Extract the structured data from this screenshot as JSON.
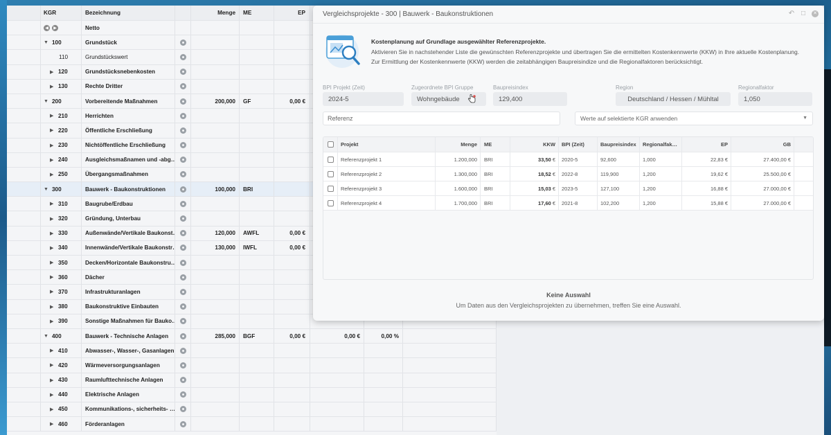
{
  "grid": {
    "headers": {
      "kgr": "KGR",
      "bezeichnung": "Bezeichnung",
      "menge": "Menge",
      "me": "ME",
      "ep": "EP"
    },
    "netto_label": "Netto",
    "rows": [
      {
        "kgr": "100",
        "name": "Grundstück",
        "level": 0,
        "toggle": "▼",
        "menge": "",
        "me": "",
        "ep": "",
        "gb": "",
        "pct": ""
      },
      {
        "kgr": "110",
        "name": "Grundstückswert",
        "level": 2,
        "toggle": "",
        "menge": "",
        "me": "",
        "ep": "",
        "gb": "",
        "pct": ""
      },
      {
        "kgr": "120",
        "name": "Grundstücksnebenkosten",
        "level": 1,
        "toggle": "▶",
        "menge": "",
        "me": "",
        "ep": "",
        "gb": "",
        "pct": ""
      },
      {
        "kgr": "130",
        "name": "Rechte Dritter",
        "level": 1,
        "toggle": "▶",
        "menge": "",
        "me": "",
        "ep": "",
        "gb": "",
        "pct": ""
      },
      {
        "kgr": "200",
        "name": "Vorbereitende Maßnahmen",
        "level": 0,
        "toggle": "▼",
        "menge": "200,000",
        "me": "GF",
        "ep": "0,00 €",
        "gb": "",
        "pct": ""
      },
      {
        "kgr": "210",
        "name": "Herrichten",
        "level": 1,
        "toggle": "▶",
        "menge": "",
        "me": "",
        "ep": "",
        "gb": "",
        "pct": ""
      },
      {
        "kgr": "220",
        "name": "Öffentliche Erschließung",
        "level": 1,
        "toggle": "▶",
        "menge": "",
        "me": "",
        "ep": "",
        "gb": "",
        "pct": ""
      },
      {
        "kgr": "230",
        "name": "Nichtöffentliche Erschließung",
        "level": 1,
        "toggle": "▶",
        "menge": "",
        "me": "",
        "ep": "",
        "gb": "",
        "pct": ""
      },
      {
        "kgr": "240",
        "name": "Ausgleichsmaßnamen und -abg…",
        "level": 1,
        "toggle": "▶",
        "menge": "",
        "me": "",
        "ep": "",
        "gb": "",
        "pct": ""
      },
      {
        "kgr": "250",
        "name": "Übergangsmaßnahmen",
        "level": 1,
        "toggle": "▶",
        "menge": "",
        "me": "",
        "ep": "",
        "gb": "",
        "pct": ""
      },
      {
        "kgr": "300",
        "name": "Bauwerk - Baukonstruktionen",
        "level": 0,
        "toggle": "▼",
        "menge": "100,000",
        "me": "BRI",
        "ep": "",
        "gb": "",
        "pct": "",
        "highlight": true
      },
      {
        "kgr": "310",
        "name": "Baugrube/Erdbau",
        "level": 1,
        "toggle": "▶",
        "menge": "",
        "me": "",
        "ep": "",
        "gb": "",
        "pct": ""
      },
      {
        "kgr": "320",
        "name": "Gründung, Unterbau",
        "level": 1,
        "toggle": "▶",
        "menge": "",
        "me": "",
        "ep": "",
        "gb": "",
        "pct": ""
      },
      {
        "kgr": "330",
        "name": "Außenwände/Vertikale Baukonst…",
        "level": 1,
        "toggle": "▶",
        "menge": "120,000",
        "me": "AWFL",
        "ep": "0,00 €",
        "gb": "",
        "pct": ""
      },
      {
        "kgr": "340",
        "name": "Innenwände/Vertikale Baukonstr…",
        "level": 1,
        "toggle": "▶",
        "menge": "130,000",
        "me": "IWFL",
        "ep": "0,00 €",
        "gb": "",
        "pct": ""
      },
      {
        "kgr": "350",
        "name": "Decken/Horizontale Baukonstru…",
        "level": 1,
        "toggle": "▶",
        "menge": "",
        "me": "",
        "ep": "",
        "gb": "",
        "pct": ""
      },
      {
        "kgr": "360",
        "name": "Dächer",
        "level": 1,
        "toggle": "▶",
        "menge": "",
        "me": "",
        "ep": "",
        "gb": "",
        "pct": ""
      },
      {
        "kgr": "370",
        "name": "Infrastrukturanlagen",
        "level": 1,
        "toggle": "▶",
        "menge": "",
        "me": "",
        "ep": "",
        "gb": "",
        "pct": ""
      },
      {
        "kgr": "380",
        "name": "Baukonstruktive Einbauten",
        "level": 1,
        "toggle": "▶",
        "menge": "",
        "me": "",
        "ep": "",
        "gb": "",
        "pct": ""
      },
      {
        "kgr": "390",
        "name": "Sonstige Maßnahmen für Bauko…",
        "level": 1,
        "toggle": "▶",
        "menge": "",
        "me": "",
        "ep": "",
        "gb": "",
        "pct": ""
      },
      {
        "kgr": "400",
        "name": "Bauwerk - Technische Anlagen",
        "level": 0,
        "toggle": "▼",
        "menge": "285,000",
        "me": "BGF",
        "ep": "0,00 €",
        "gb": "0,00 €",
        "pct": "0,00 %"
      },
      {
        "kgr": "410",
        "name": "Abwasser-, Wasser-, Gasanlagen",
        "level": 1,
        "toggle": "▶",
        "menge": "",
        "me": "",
        "ep": "",
        "gb": "",
        "pct": ""
      },
      {
        "kgr": "420",
        "name": "Wärmeversorgungsanlagen",
        "level": 1,
        "toggle": "▶",
        "menge": "",
        "me": "",
        "ep": "",
        "gb": "",
        "pct": ""
      },
      {
        "kgr": "430",
        "name": "Raumlufttechnische Anlagen",
        "level": 1,
        "toggle": "▶",
        "menge": "",
        "me": "",
        "ep": "",
        "gb": "",
        "pct": ""
      },
      {
        "kgr": "440",
        "name": "Elektrische Anlagen",
        "level": 1,
        "toggle": "▶",
        "menge": "",
        "me": "",
        "ep": "",
        "gb": "",
        "pct": ""
      },
      {
        "kgr": "450",
        "name": "Kommunikations-, sicherheits- …",
        "level": 1,
        "toggle": "▶",
        "menge": "",
        "me": "",
        "ep": "",
        "gb": "",
        "pct": ""
      },
      {
        "kgr": "460",
        "name": "Förderanlagen",
        "level": 1,
        "toggle": "▶",
        "menge": "",
        "me": "",
        "ep": "",
        "gb": "",
        "pct": ""
      }
    ]
  },
  "modal": {
    "title": "Vergleichsprojekte - 300 | Bauwerk - Baukonstruktionen",
    "intro_title": "Kostenplanung auf Grundlage ausgewählter Referenzprojekte.",
    "intro_text": "Aktivieren Sie in nachstehender Liste die gewünschten Referenzprojekte und übertragen Sie die ermittelten Kostenkennwerte (KKW) in Ihre aktuelle Kostenplanung. Zur Ermittlung der Kostenkennwerte (KKW) werden die zeitabhängigen Baupreisindize und die Regionalfaktoren berücksichtigt.",
    "fields": {
      "bpi_label": "BPI Projekt (Zeit)",
      "bpi_value": "2024-5",
      "gruppe_label": "Zugeordnete BPI Gruppe",
      "gruppe_value": "Wohngebäude",
      "baupreisindex_label": "Baupreisindex",
      "baupreisindex_value": "129,400",
      "region_label": "Region",
      "region_value": "Deutschland / Hessen / Mühltal",
      "regionalfaktor_label": "Regionalfaktor",
      "regionalfaktor_value": "1,050"
    },
    "referenz_placeholder": "Referenz",
    "apply_select": "Werte auf selektierte KGR anwenden",
    "table": {
      "headers": {
        "projekt": "Projekt",
        "menge": "Menge",
        "me": "ME",
        "kkw": "KKW",
        "bpi": "BPI (Zeit)",
        "baupreisindex": "Baupreisindex",
        "regionalfak": "Regionalfak…",
        "ep": "EP",
        "gb": "GB"
      },
      "rows": [
        {
          "projekt": "Referenzprojekt 1",
          "menge": "1.200,000",
          "me": "BRI",
          "kkw": "33,50",
          "cur": "€",
          "bpi": "2020-5",
          "baupreisindex": "92,600",
          "regionalfak": "1,000",
          "ep": "22,83 €",
          "gb": "27.400,00 €"
        },
        {
          "projekt": "Referenzprojekt 2",
          "menge": "1.300,000",
          "me": "BRI",
          "kkw": "18,52",
          "cur": "€",
          "bpi": "2022-8",
          "baupreisindex": "119,900",
          "regionalfak": "1,200",
          "ep": "19,62 €",
          "gb": "25.500,00 €"
        },
        {
          "projekt": "Referenzprojekt 3",
          "menge": "1.600,000",
          "me": "BRI",
          "kkw": "15,03",
          "cur": "€",
          "bpi": "2023-5",
          "baupreisindex": "127,100",
          "regionalfak": "1,200",
          "ep": "16,88 €",
          "gb": "27.000,00 €"
        },
        {
          "projekt": "Referenzprojekt 4",
          "menge": "1.700,000",
          "me": "BRI",
          "kkw": "17,60",
          "cur": "€",
          "bpi": "2021-8",
          "baupreisindex": "102,200",
          "regionalfak": "1,200",
          "ep": "15,88 €",
          "gb": "27.000,00 €"
        }
      ]
    },
    "empty_title": "Keine Auswahl",
    "empty_text": "Um Daten aus den Vergleichsprojekten zu übernehmen, treffen Sie eine Auswahl."
  }
}
